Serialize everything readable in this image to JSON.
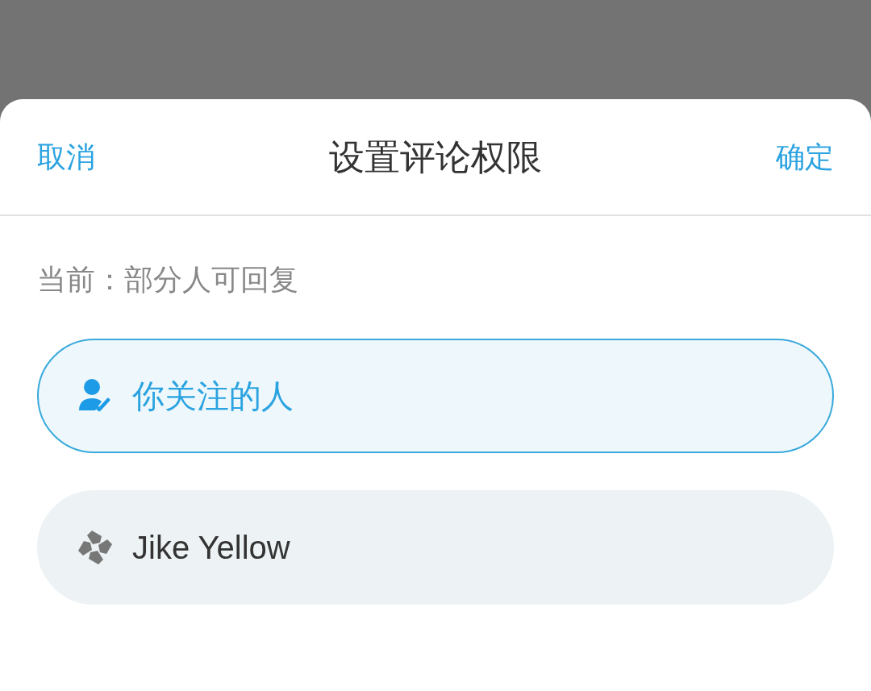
{
  "header": {
    "cancel": "取消",
    "title": "设置评论权限",
    "confirm": "确定"
  },
  "current": "当前：部分人可回复",
  "options": [
    {
      "kind": "following",
      "label": "你关注的人",
      "selected": true
    },
    {
      "kind": "group",
      "label": "Jike Yellow",
      "selected": false
    }
  ]
}
